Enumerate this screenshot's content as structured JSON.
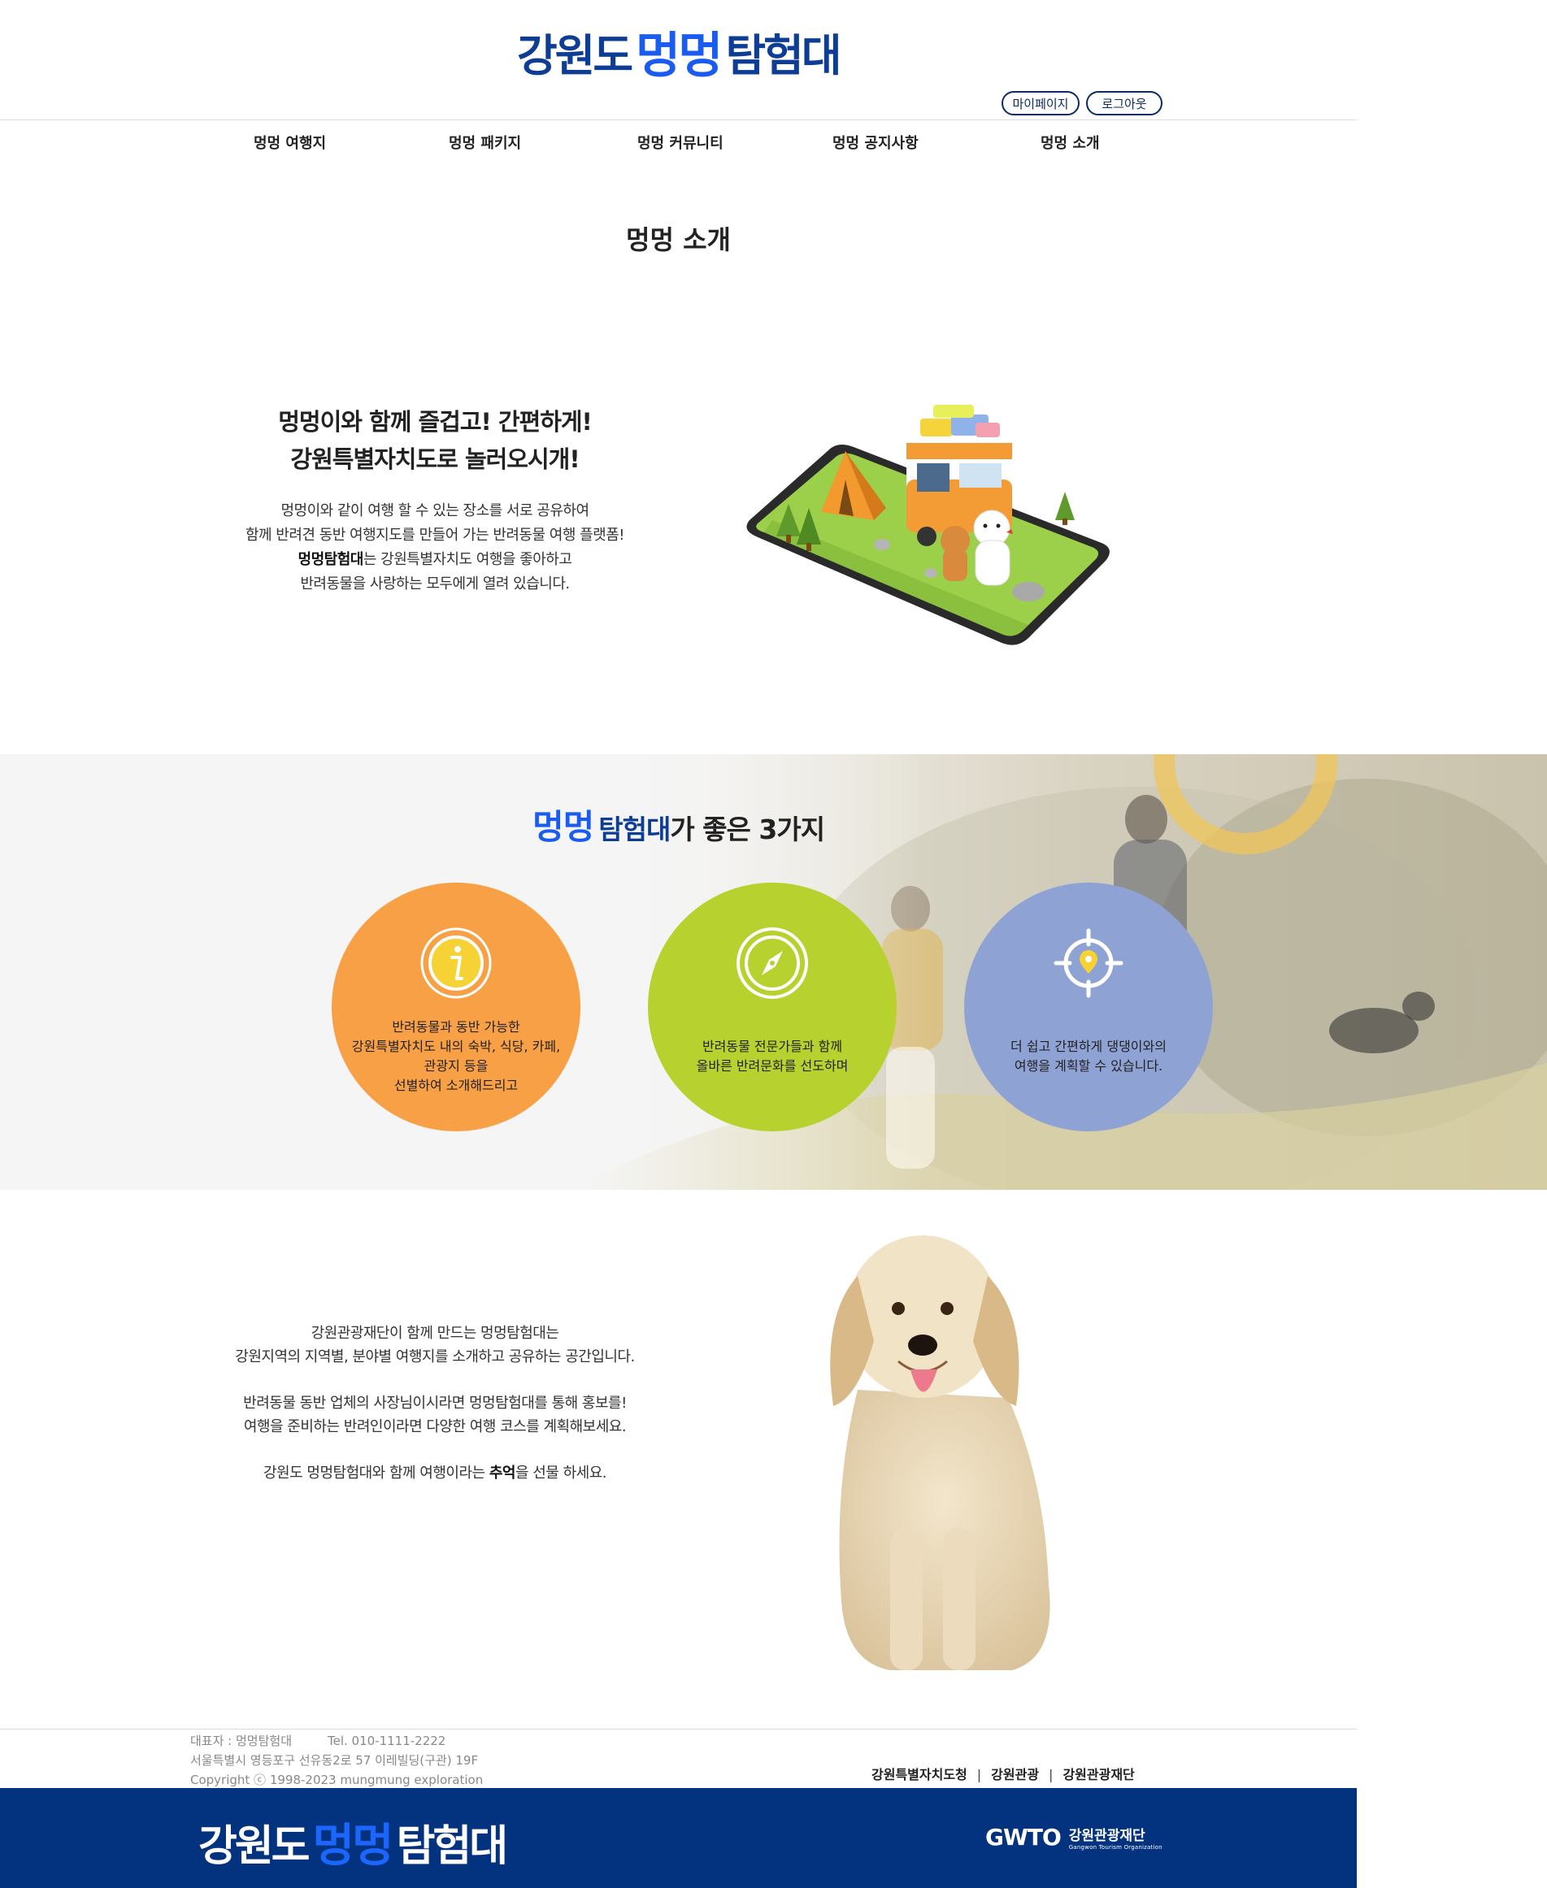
{
  "header": {
    "logo": {
      "part1": "강원도",
      "part2": "멍멍",
      "part3": "탐험대"
    },
    "util": {
      "mypage": "마이페이지",
      "logout": "로그아웃"
    },
    "nav": [
      "멍멍 여행지",
      "멍멍 패키지",
      "멍멍 커뮤니티",
      "멍멍 공지사항",
      "멍멍 소개"
    ]
  },
  "page_title": "멍멍 소개",
  "intro": {
    "heading_line1": "멍멍이와 함께 즐겁고! 간편하게!",
    "heading_line2": "강원특별자치도로 놀러오시개!",
    "body_line1": "멍멍이와 같이 여행 할 수 있는 장소를 서로 공유하여",
    "body_line2": "함께 반려견 동반 여행지도를 만들어 가는 반려동물 여행 플랫폼!",
    "body_line3_bold": "멍멍탐험대",
    "body_line3_rest": "는 강원특별자치도 여행을 좋아하고",
    "body_line4": "반려동물을 사랑하는 모두에게 열려 있습니다."
  },
  "why": {
    "title_mm": "멍멍",
    "title_tt": "탐험대",
    "title_rest": "가 좋은 3가지",
    "items": [
      {
        "icon": "info-icon",
        "lines": [
          "반려동물과 동반 가능한",
          "강원특별자치도 내의 숙박, 식당, 카페,",
          "관광지 등을",
          "선별하여 소개해드리고"
        ]
      },
      {
        "icon": "compass-icon",
        "lines": [
          "반려동물 전문가들과 함께",
          "올바른 반려문화를 선도하며"
        ]
      },
      {
        "icon": "location-target-icon",
        "lines": [
          "더 쉽고 간편하게 댕댕이와의",
          "여행을 계획할 수 있습니다."
        ]
      }
    ],
    "colors": {
      "orange": "#f8a045",
      "green": "#b7d22e",
      "purple": "#8fa2d4"
    }
  },
  "about": {
    "p1_line1": "강원관광재단이 함께 만드는 멍멍탐험대는",
    "p1_line2": "강원지역의 지역별, 분야별 여행지를 소개하고 공유하는 공간입니다.",
    "p2_line1": "반려동물 동반 업체의 사장님이시라면 멍멍탐험대를 통해 홍보를!",
    "p2_line2": "여행을 준비하는 반려인이라면 다양한 여행 코스를 계획해보세요.",
    "p3_pre": "강원도 멍멍탐험대와 함께 여행이라는 ",
    "p3_bold": "추억",
    "p3_post": "을 선물 하세요."
  },
  "footer": {
    "rep": "대표자 : 멍멍탐험대",
    "tel": "Tel. 010-1111-2222",
    "address": "서울특별시 영등포구 선유동2로 57 이레빌딩(구관) 19F",
    "copyright": "Copyright ⓒ 1998-2023 mungmung exploration",
    "links": [
      "강원특별자치도청",
      "강원관광",
      "강원관광재단"
    ],
    "logo": {
      "part1": "강원도",
      "part2": "멍멍",
      "part3": "탐험대"
    },
    "gwto_mark": "GWTO",
    "gwto_ko": "강원관광재단",
    "gwto_en": "Gangwon Tourism Organization"
  },
  "colors": {
    "navy": "#03327e",
    "brand_blue": "#1a5cf0"
  }
}
